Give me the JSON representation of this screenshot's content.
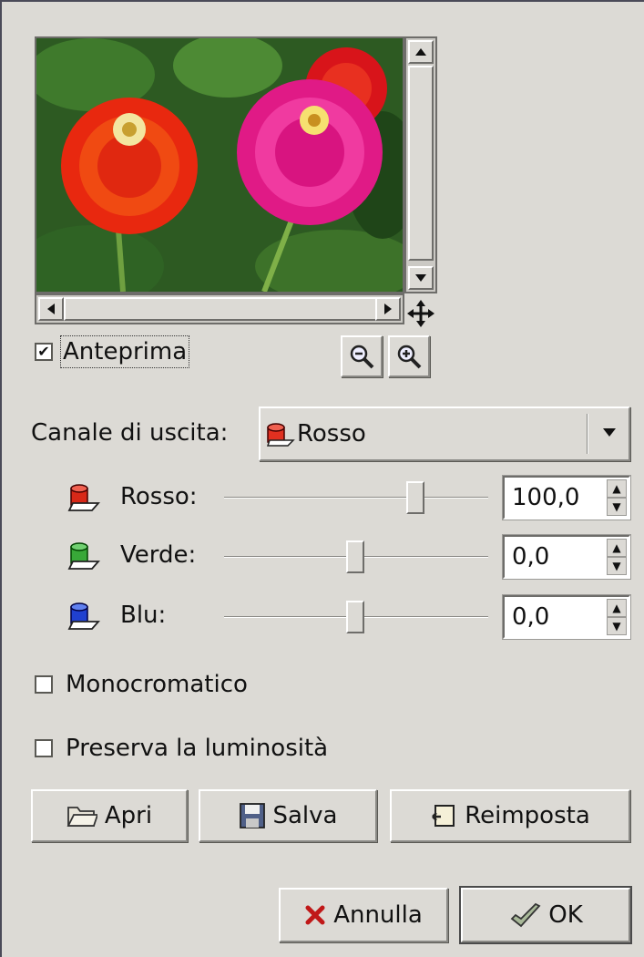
{
  "preview": {
    "checkbox_label": "Anteprima",
    "checked": true,
    "zoom_out_icon": "zoom-out-icon",
    "zoom_in_icon": "zoom-in-icon",
    "navigate_icon": "move-cross-icon"
  },
  "output_channel": {
    "label": "Canale di uscita:",
    "selected": "Rosso"
  },
  "channels": [
    {
      "label": "Rosso:",
      "value": "100,0",
      "color": "#d02020"
    },
    {
      "label": "Verde:",
      "value": "0,0",
      "color": "#30a030"
    },
    {
      "label": "Blu:",
      "value": "0,0",
      "color": "#2040d0"
    }
  ],
  "options": {
    "monochrome": "Monocromatico",
    "preserve": "Preserva la luminosità"
  },
  "buttons": {
    "open": "Apri",
    "save": "Salva",
    "reset": "Reimposta",
    "cancel": "Annulla",
    "ok": "OK"
  }
}
